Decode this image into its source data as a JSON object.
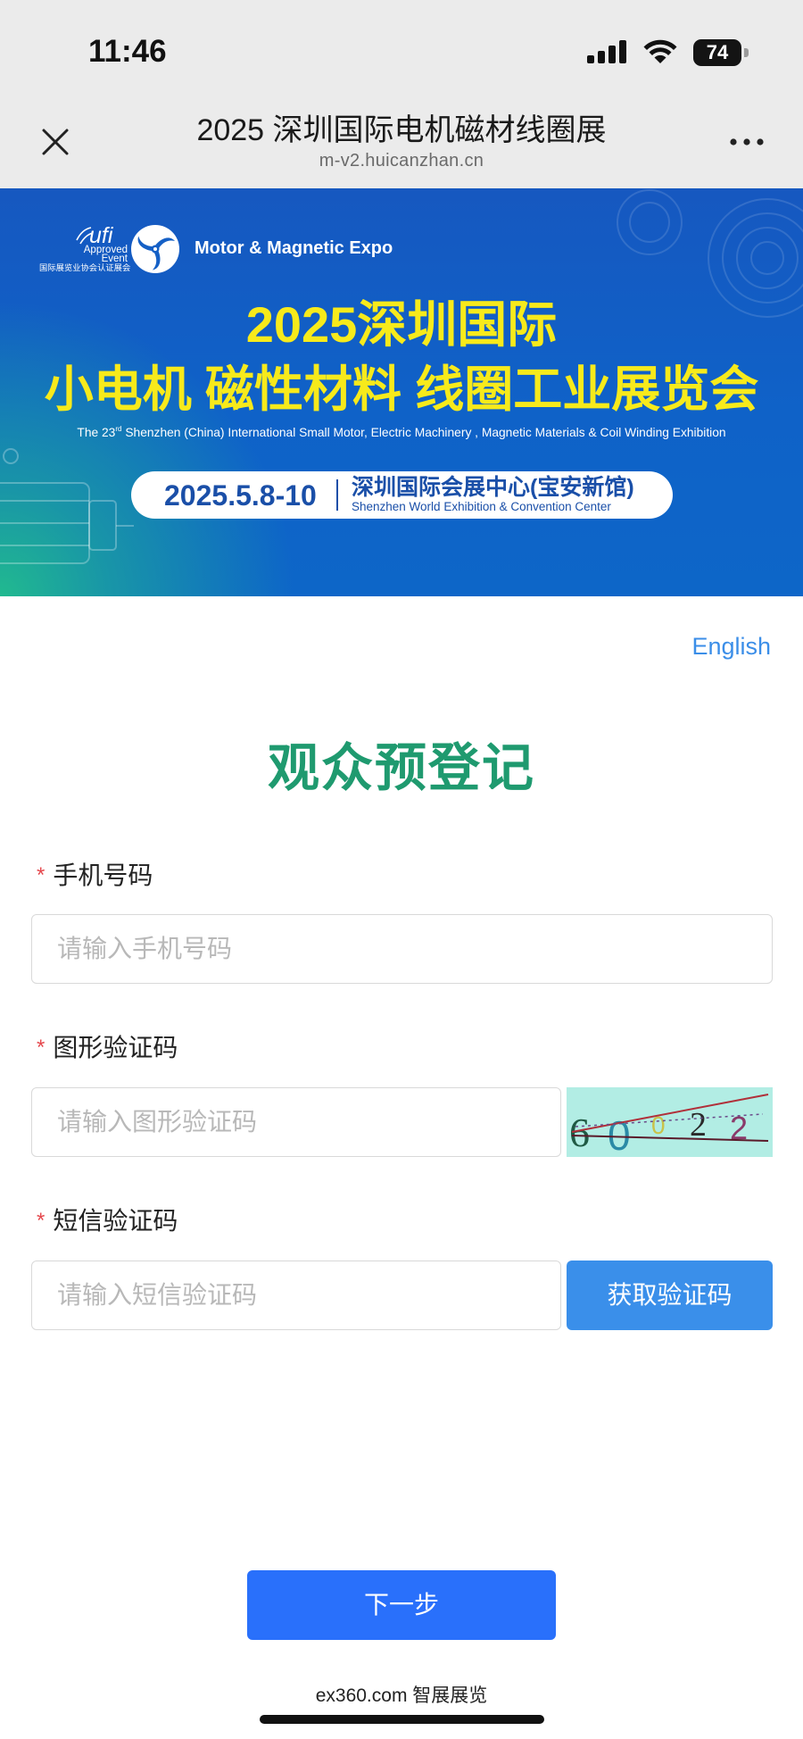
{
  "status_bar": {
    "time": "11:46",
    "battery": "74",
    "icons": [
      "signal-icon",
      "wifi-icon",
      "battery-icon"
    ]
  },
  "header": {
    "title": "2025 深圳国际电机磁材线圈展",
    "url": "m-v2.huicanzhan.cn",
    "close_icon": "close-icon",
    "more_icon": "more-icon"
  },
  "banner": {
    "ufi": {
      "text": "ufi",
      "line1": "Approved",
      "line2": "Event",
      "caption": "国际展览业协会认证展会"
    },
    "brand": "Motor & Magnetic Expo",
    "title_line1": "2025深圳国际",
    "title_line2": "小电机 磁性材料 线圈工业展览会",
    "subtitle_pre": "The 23",
    "subtitle_sup": "rd",
    "subtitle_post": " Shenzhen (China) International Small Motor, Electric Machinery , Magnetic Materials & Coil Winding Exhibition",
    "date": "2025.5.8-10",
    "venue_cn": "深圳国际会展中心(宝安新馆)",
    "venue_en": "Shenzhen World Exhibition & Convention Center"
  },
  "lang_link": "English",
  "form": {
    "title": "观众预登记",
    "required_mark": "*",
    "phone": {
      "label": "手机号码",
      "placeholder": "请输入手机号码",
      "value": ""
    },
    "captcha": {
      "label": "图形验证码",
      "placeholder": "请输入图形验证码",
      "value": "",
      "image_chars": [
        "6",
        "0",
        "0",
        "2",
        "2"
      ]
    },
    "sms": {
      "label": "短信验证码",
      "placeholder": "请输入短信验证码",
      "value": "",
      "button": "获取验证码"
    },
    "next_button": "下一步"
  },
  "footer": {
    "text": "ex360.com 智展展览"
  },
  "colors": {
    "chrome_bg": "#ebebeb",
    "banner_blue": "#0f62c8",
    "banner_yellow": "#f7ea1b",
    "form_title_green": "#1f9a6f",
    "link_blue": "#3b8ee8",
    "required_red": "#e5484d",
    "sms_button": "#3a8fea",
    "next_button": "#2970fb"
  }
}
